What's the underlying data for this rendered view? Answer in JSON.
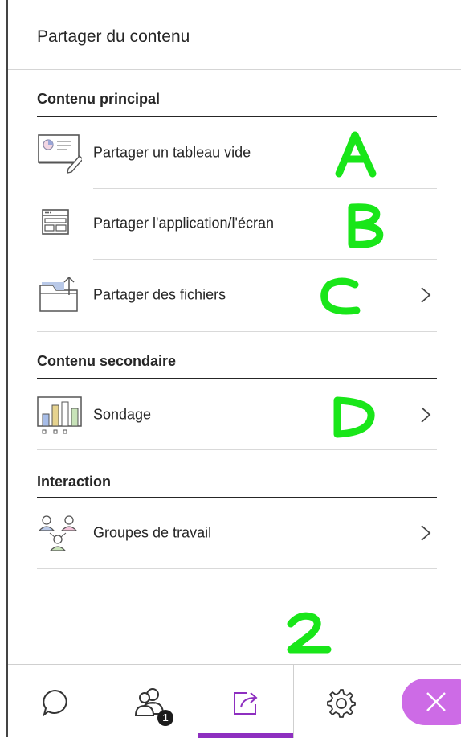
{
  "panel": {
    "title": "Partager du contenu"
  },
  "sections": {
    "primary": {
      "title": "Contenu principal",
      "items": [
        {
          "label": "Partager un tableau vide",
          "annotation": "A"
        },
        {
          "label": "Partager l'application/l'écran",
          "annotation": "B"
        },
        {
          "label": "Partager des fichiers",
          "annotation": "C",
          "has_chevron": true
        }
      ]
    },
    "secondary": {
      "title": "Contenu secondaire",
      "items": [
        {
          "label": "Sondage",
          "annotation": "D",
          "has_chevron": true
        }
      ]
    },
    "interaction": {
      "title": "Interaction",
      "items": [
        {
          "label": "Groupes de travail",
          "has_chevron": true
        }
      ]
    }
  },
  "bottom_bar": {
    "tabs": [
      {
        "name": "chat",
        "icon": "chat-bubble-icon"
      },
      {
        "name": "participants",
        "icon": "participants-icon",
        "badge": "1"
      },
      {
        "name": "share-content",
        "icon": "share-icon",
        "active": true,
        "annotation": "2"
      },
      {
        "name": "settings",
        "icon": "gear-icon"
      },
      {
        "name": "close",
        "icon": "close-icon"
      }
    ]
  },
  "colors": {
    "accent_purple": "#8e2fc0",
    "close_button": "#cd6be6",
    "annotation_green": "#19e619",
    "text": "#262626"
  }
}
